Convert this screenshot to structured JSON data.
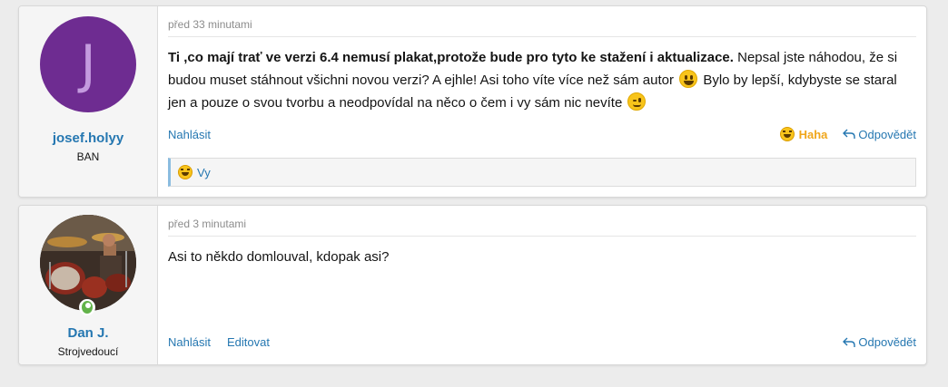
{
  "posts": [
    {
      "author": {
        "avatar_letter": "J",
        "avatar_color": "#6e2c91",
        "name": "josef.holyy",
        "title": "BAN"
      },
      "time": "před 33 minutami",
      "content": {
        "bold": "Ti ,co mají trať ve verzi 6.4 nemusí plakat,protože bude pro tyto ke stažení i aktualizace.",
        "text1": " Nepsal jste náhodou, že si budou muset stáhnout všichni novou verzi? A ejhle! Asi toho víte více než sám autor ",
        "emoji1": "grinning-emoji",
        "text2": " Bylo by lepší, kdybyste se staral jen a pouze o svou tvorbu a neodpovídal na něco o čem i vy sám nic nevíte ",
        "emoji2": "wink-emoji"
      },
      "actions": {
        "report": "Nahlásit",
        "reaction": "Haha",
        "reply": "Odpovědět"
      },
      "reactions_bar": {
        "icon": "haha-reaction-icon",
        "who": "Vy"
      }
    },
    {
      "author": {
        "avatar": "user-photo",
        "online": true,
        "name": "Dan J.",
        "title": "Strojvedoucí"
      },
      "time": "před 3 minutami",
      "content": {
        "text": "Asi to někdo domlouval, kdopak asi?"
      },
      "actions": {
        "report": "Nahlásit",
        "edit": "Editovat",
        "reply": "Odpovědět"
      }
    }
  ],
  "colors": {
    "link": "#2577b1",
    "haha": "#f0a61a",
    "online": "#63b34a",
    "background": "#ececec"
  }
}
